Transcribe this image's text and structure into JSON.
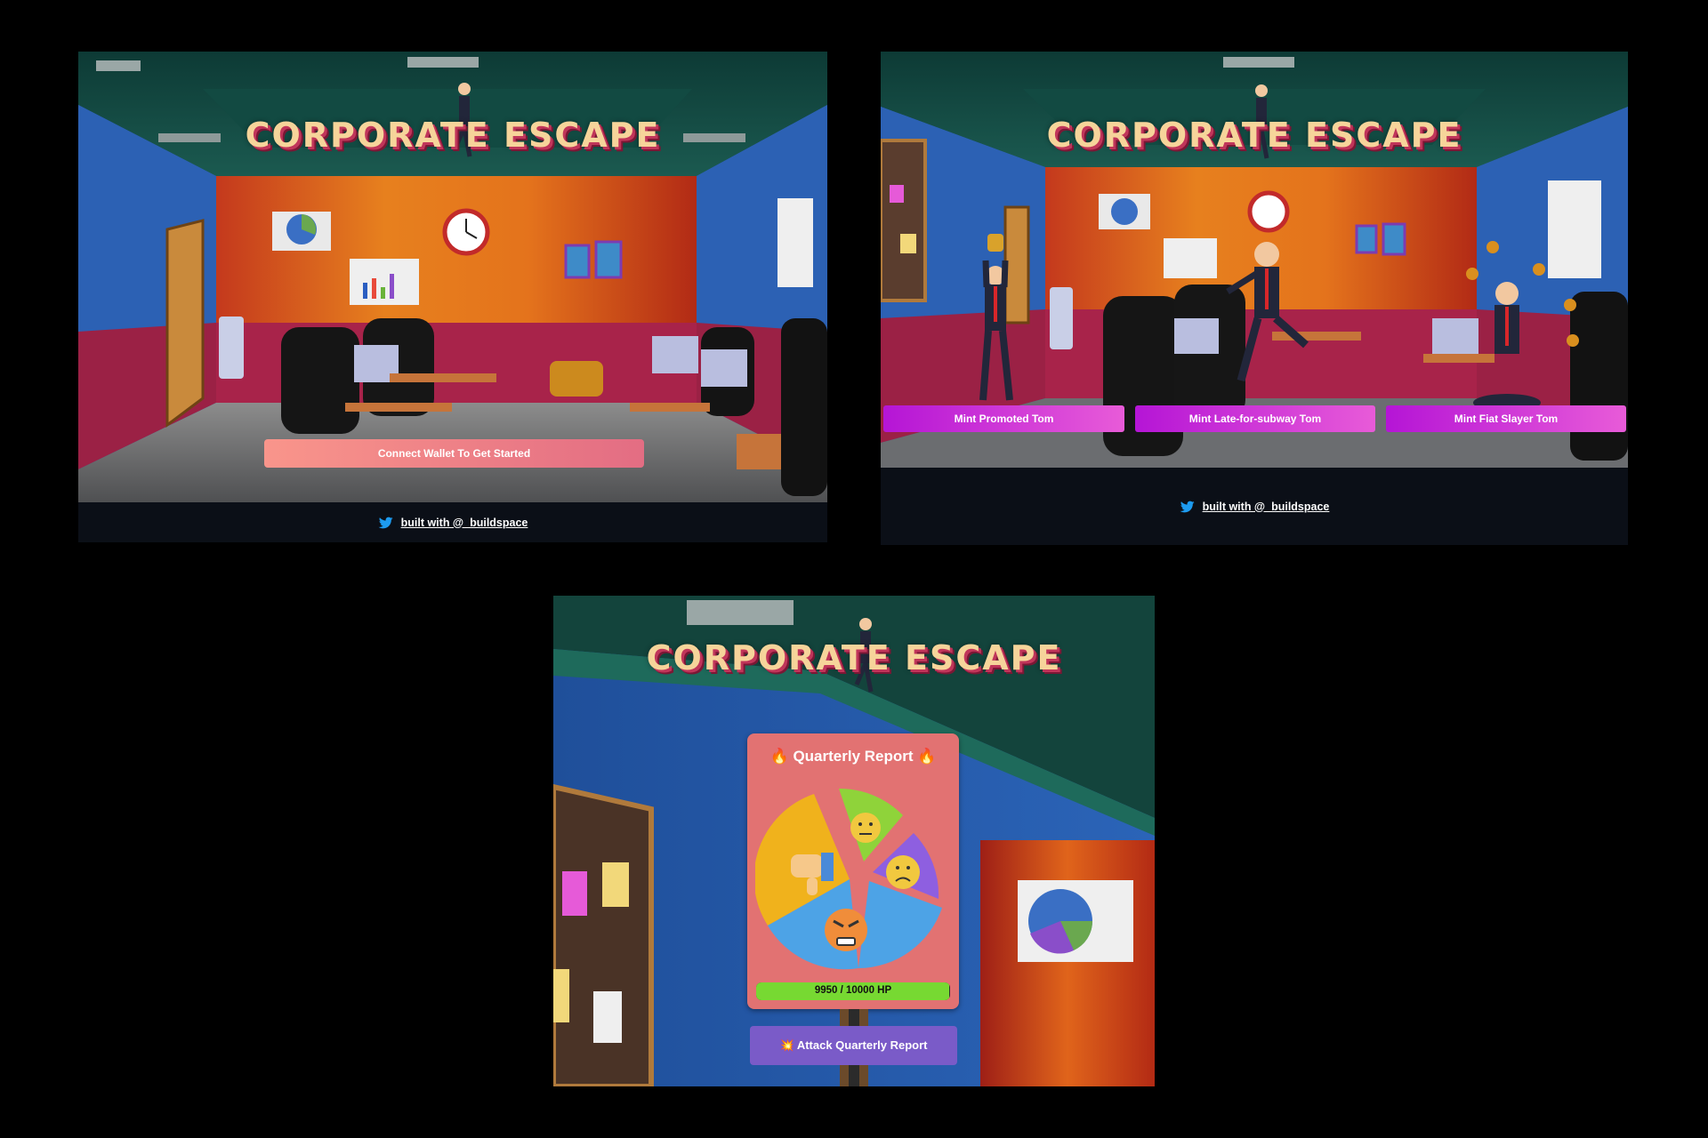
{
  "game": {
    "title": "CORPORATE ESCAPE"
  },
  "screen_connect": {
    "connect_button": "Connect Wallet To Get Started",
    "footer_link": "built with @_buildspace"
  },
  "screen_mint": {
    "characters": [
      {
        "button": "Mint Promoted Tom"
      },
      {
        "button": "Mint Late-for-subway Tom"
      },
      {
        "button": "Mint Fiat Slayer Tom"
      }
    ],
    "footer_link": "built with @_buildspace"
  },
  "screen_arena": {
    "boss_name": "🔥 Quarterly Report 🔥",
    "hp_text": "9950 / 10000 HP",
    "hp_current": 9950,
    "hp_max": 10000,
    "attack_button": "💥 Attack Quarterly Report"
  },
  "colors": {
    "background": "#000000",
    "footer": "#0b0f17",
    "connect_button": "#f08a86",
    "mint_button": "#c52ad8",
    "boss_card": "#e27272",
    "hp_fill": "#77d932",
    "attack_button": "#7a5bc8",
    "twitter": "#1d9bf0"
  },
  "icons": [
    "twitter-icon",
    "fire-icon",
    "explosion-icon"
  ]
}
